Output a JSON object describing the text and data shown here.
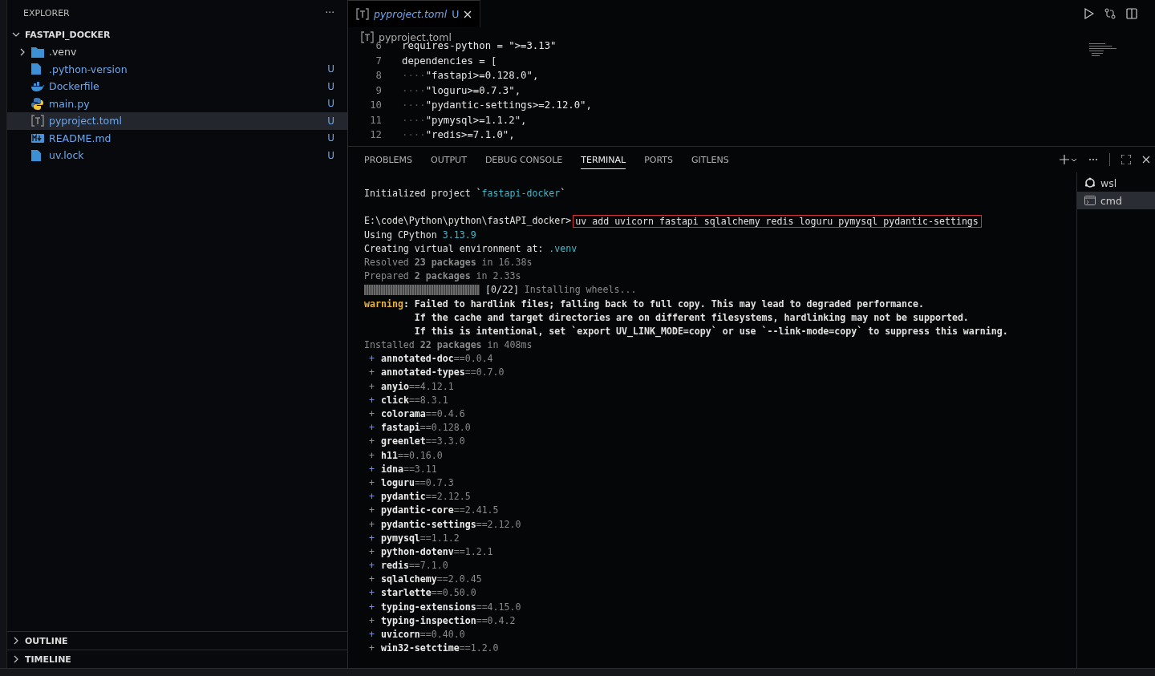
{
  "sidebar": {
    "title": "EXPLORER",
    "more": "···",
    "folder": {
      "label": "FASTAPI_DOCKER",
      "expanded": true
    },
    "items": [
      {
        "label": ".venv",
        "kind": "folder",
        "expanded": false,
        "selected": false
      },
      {
        "label": ".python-version",
        "kind": "file",
        "status": "U",
        "selected": false
      },
      {
        "label": "Dockerfile",
        "kind": "docker",
        "status": "U",
        "selected": false
      },
      {
        "label": "main.py",
        "kind": "python",
        "status": "U",
        "selected": false
      },
      {
        "label": "pyproject.toml",
        "kind": "toml",
        "status": "U",
        "selected": true
      },
      {
        "label": "README.md",
        "kind": "markdown",
        "status": "U",
        "selected": false
      },
      {
        "label": "uv.lock",
        "kind": "file",
        "status": "U",
        "selected": false
      }
    ],
    "sections": [
      {
        "label": "OUTLINE",
        "expanded": false
      },
      {
        "label": "TIMELINE",
        "expanded": false
      }
    ]
  },
  "editor": {
    "tabs": [
      {
        "label": "pyproject.toml",
        "status": "U",
        "selected": true
      }
    ],
    "breadcrumb": "pyproject.toml",
    "lines": [
      {
        "num": "6",
        "text": "requires-python = \">=3.13\""
      },
      {
        "num": "7",
        "text": "dependencies = ["
      },
      {
        "num": "8",
        "indent": "····",
        "text": "\"fastapi>=0.128.0\","
      },
      {
        "num": "9",
        "indent": "····",
        "text": "\"loguru>=0.7.3\","
      },
      {
        "num": "10",
        "indent": "····",
        "text": "\"pydantic-settings>=2.12.0\","
      },
      {
        "num": "11",
        "indent": "····",
        "text": "\"pymysql>=1.1.2\","
      },
      {
        "num": "12",
        "indent": "····",
        "text": "\"redis>=7.1.0\","
      }
    ]
  },
  "panel": {
    "tabs": [
      {
        "label": "PROBLEMS",
        "selected": false
      },
      {
        "label": "OUTPUT",
        "selected": false
      },
      {
        "label": "DEBUG CONSOLE",
        "selected": false
      },
      {
        "label": "TERMINAL",
        "selected": true
      },
      {
        "label": "PORTS",
        "selected": false
      },
      {
        "label": "GITLENS",
        "selected": false
      }
    ],
    "terminals": [
      {
        "label": "wsl",
        "kind": "linux",
        "selected": false
      },
      {
        "label": "cmd",
        "kind": "cmd",
        "selected": true
      }
    ],
    "output": [
      {
        "kind": "text",
        "segments": [
          {
            "text": "Initialized project `",
            "kind": "plain"
          },
          {
            "text": "fastapi-docker",
            "kind": "cyan"
          },
          {
            "text": "`",
            "kind": "plain"
          }
        ]
      },
      {
        "kind": "blank"
      },
      {
        "kind": "text",
        "segments": [
          {
            "text": "E:\\code\\Python\\python\\fastAPI_docker>",
            "kind": "plain"
          },
          {
            "text": "uv add uvicorn fastapi sqlalchemy redis loguru pymysql pydantic-settings",
            "kind": "boxed"
          }
        ]
      },
      {
        "kind": "text",
        "segments": [
          {
            "text": "Using CPython ",
            "kind": "plain"
          },
          {
            "text": "3.13.9",
            "kind": "cyan"
          }
        ]
      },
      {
        "kind": "text",
        "segments": [
          {
            "text": "Creating virtual environment at: ",
            "kind": "plain"
          },
          {
            "text": ".venv",
            "kind": "cyan"
          }
        ]
      },
      {
        "kind": "text",
        "segments": [
          {
            "text": "Resolved ",
            "kind": "dim"
          },
          {
            "text": "23 packages",
            "kind": "dimbold"
          },
          {
            "text": " in 16.38s",
            "kind": "dim"
          }
        ]
      },
      {
        "kind": "text",
        "segments": [
          {
            "text": "Prepared ",
            "kind": "dim"
          },
          {
            "text": "2 packages",
            "kind": "dimbold"
          },
          {
            "text": " in 2.33s",
            "kind": "dim"
          }
        ]
      },
      {
        "kind": "progress",
        "level": 0,
        "segments": [
          {
            "text": " [0/22] ",
            "kind": "plain"
          },
          {
            "text": "Installing wheels...",
            "kind": "dim"
          }
        ]
      },
      {
        "kind": "text",
        "segments": [
          {
            "text": "warning",
            "kind": "warn"
          },
          {
            "text": ": Failed to hardlink files; falling back to full copy. This may lead to degraded performance.",
            "kind": "bold"
          }
        ]
      },
      {
        "kind": "text",
        "segments": [
          {
            "text": "         If the cache and target directories are on different filesystems, hardlinking may not be supported.",
            "kind": "bold"
          }
        ]
      },
      {
        "kind": "text",
        "segments": [
          {
            "text": "         If this is intentional, set `export UV_LINK_MODE=copy` or use `--link-mode=copy` to suppress this warning.",
            "kind": "bold"
          }
        ]
      },
      {
        "kind": "text",
        "segments": [
          {
            "text": "Installed ",
            "kind": "dim"
          },
          {
            "text": "22 packages",
            "kind": "dimbold"
          },
          {
            "text": " in 408ms",
            "kind": "dim"
          }
        ]
      }
    ],
    "packages": [
      {
        "name": "annotated-doc",
        "version": "==0.0.4"
      },
      {
        "name": "annotated-types",
        "version": "==0.7.0"
      },
      {
        "name": "anyio",
        "version": "==4.12.1"
      },
      {
        "name": "click",
        "version": "==8.3.1"
      },
      {
        "name": "colorama",
        "version": "==0.4.6"
      },
      {
        "name": "fastapi",
        "version": "==0.128.0"
      },
      {
        "name": "greenlet",
        "version": "==3.3.0"
      },
      {
        "name": "h11",
        "version": "==0.16.0"
      },
      {
        "name": "idna",
        "version": "==3.11"
      },
      {
        "name": "loguru",
        "version": "==0.7.3"
      },
      {
        "name": "pydantic",
        "version": "==2.12.5"
      },
      {
        "name": "pydantic-core",
        "version": "==2.41.5"
      },
      {
        "name": "pydantic-settings",
        "version": "==2.12.0"
      },
      {
        "name": "pymysql",
        "version": "==1.1.2"
      },
      {
        "name": "python-dotenv",
        "version": "==1.2.1"
      },
      {
        "name": "redis",
        "version": "==7.1.0"
      },
      {
        "name": "sqlalchemy",
        "version": "==2.0.45"
      },
      {
        "name": "starlette",
        "version": "==0.50.0"
      },
      {
        "name": "typing-extensions",
        "version": "==4.15.0"
      },
      {
        "name": "typing-inspection",
        "version": "==0.4.2"
      },
      {
        "name": "uvicorn",
        "version": "==0.40.0"
      },
      {
        "name": "win32-setctime",
        "version": "==1.2.0"
      }
    ],
    "plus": "+"
  }
}
